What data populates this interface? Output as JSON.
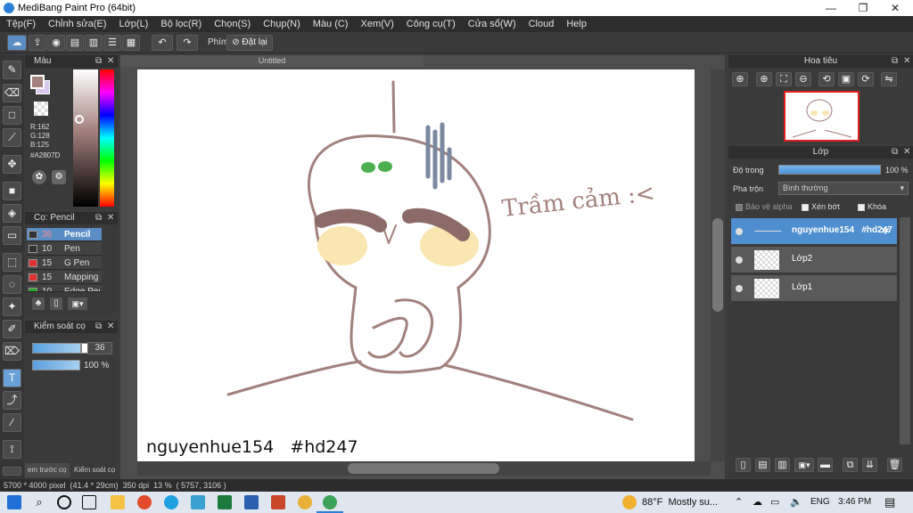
{
  "window": {
    "title": "MediBang Paint Pro (64bit)",
    "min": "—",
    "max": "❐",
    "close": "✕"
  },
  "menu": [
    "Tệp(F)",
    "Chỉnh sửa(E)",
    "Lớp(L)",
    "Bộ lọc(R)",
    "Chọn(S)",
    "Chụp(N)",
    "Màu (C)",
    "Xem(V)",
    "Công cụ(T)",
    "Cửa sổ(W)",
    "Cloud",
    "Help"
  ],
  "toolbar": {
    "shortcut_label": "Phím",
    "reset_label": "Đặt lại"
  },
  "color_panel": {
    "title": "Màu",
    "r": "R:162",
    "g": "G:128",
    "b": "B:125",
    "hex": "#A2807D",
    "fg_color": "#A2807D"
  },
  "brush_panel": {
    "title": "Cọ: Pencil",
    "items": [
      {
        "size": "36",
        "name": "Pencil",
        "color": "#333333"
      },
      {
        "size": "10",
        "name": "Pen",
        "color": "#333333"
      },
      {
        "size": "15",
        "name": "G Pen",
        "color": "#e03030"
      },
      {
        "size": "15",
        "name": "Mapping Pen",
        "color": "#e03030"
      },
      {
        "size": "10",
        "name": "Edge Pen",
        "color": "#22aa22"
      }
    ]
  },
  "brush_control": {
    "title": "Kiểm soát cọ",
    "size": "36",
    "opacity": "100 %"
  },
  "bottom_tabs": [
    "em trước cọ",
    "Kiểm soát cọ"
  ],
  "document": {
    "tab_title": "Untitled",
    "signature": "nguyenhue154   #hd247",
    "caption": "Trầm cảm :<"
  },
  "navigator": {
    "title": "Hoa tiêu"
  },
  "layers": {
    "title": "Lớp",
    "opacity_label": "Độ trong",
    "opacity_value": "100 %",
    "blend_label": "Pha trộn",
    "blend_value": "Bình thường",
    "protect_alpha": "Bảo vệ alpha",
    "clipping": "Xén bớt",
    "lock": "Khóa",
    "items": [
      {
        "name": "nguyenhue154   #hd247",
        "selected": true
      },
      {
        "name": "Lớp2",
        "selected": false
      },
      {
        "name": "Lớp1",
        "selected": false
      }
    ]
  },
  "status": {
    "text": "5700 * 4000 pixel  (41.4 * 29cm)  350 dpi  13 %  ( 5757, 3106 )"
  },
  "taskbar": {
    "weather": "88°F  Mostly su...",
    "lang": "ENG",
    "time": "3:46 PM"
  }
}
